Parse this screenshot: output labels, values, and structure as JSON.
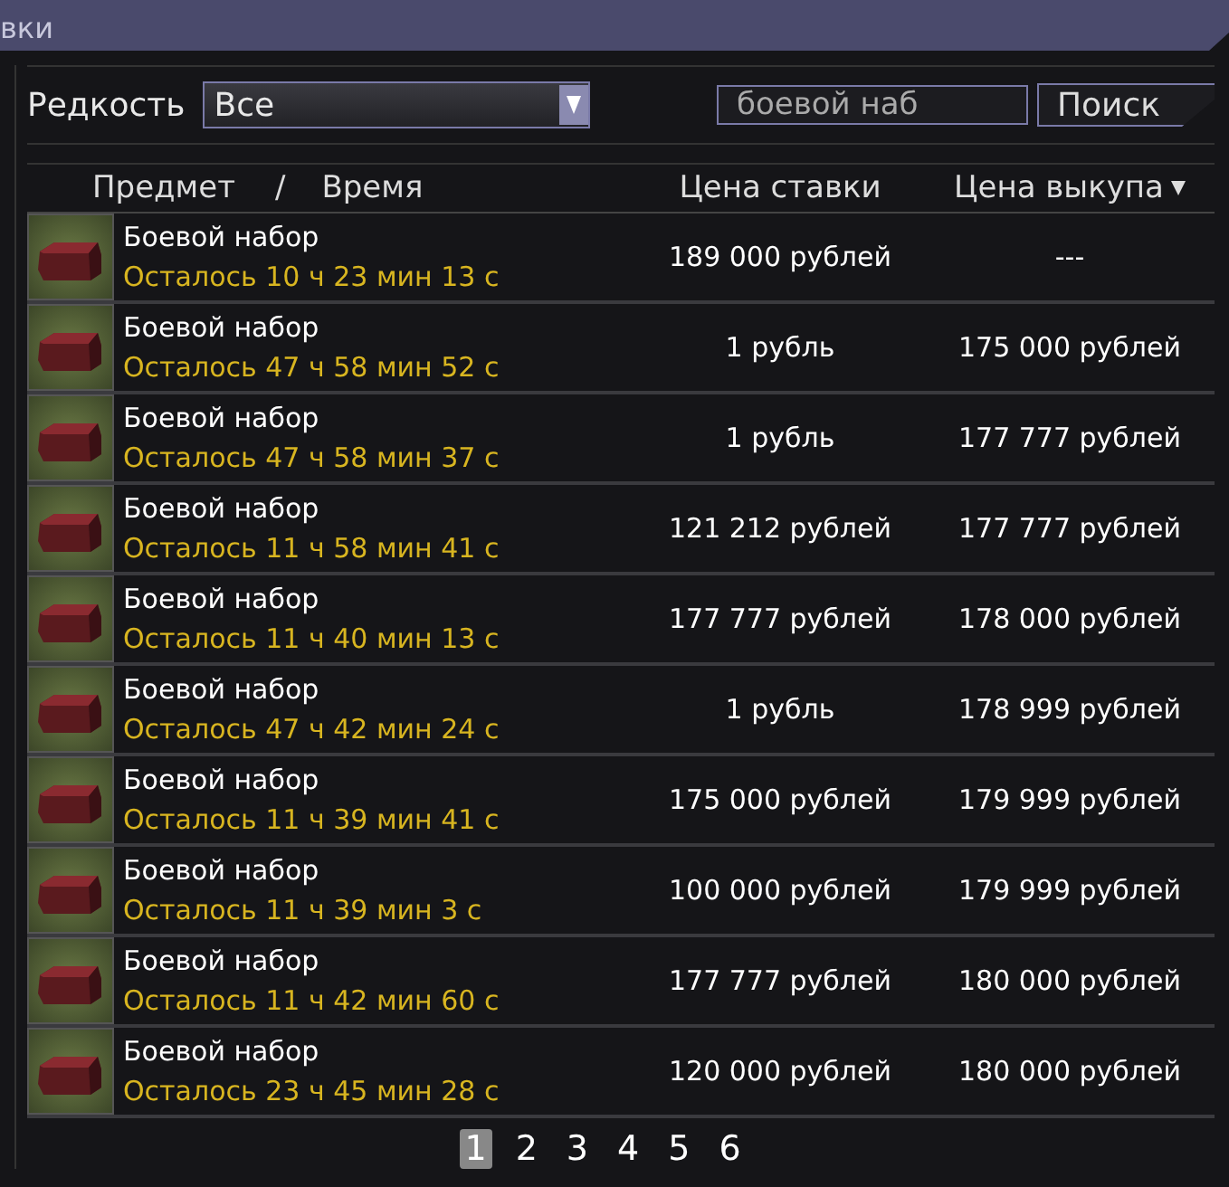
{
  "window": {
    "title": "вки"
  },
  "filters": {
    "rarity_label": "Редкость",
    "rarity_value": "Все",
    "search_value": "боевой наб",
    "search_button": "Поиск"
  },
  "columns": [
    {
      "label": "Предмет"
    },
    {
      "label": "/"
    },
    {
      "label": "Время"
    },
    {
      "label": "Цена ставки"
    },
    {
      "label": "Цена выкупа",
      "sorted": true
    }
  ],
  "rows": [
    {
      "name": "Боевой набор",
      "time": "Осталось 10 ч 23 мин 13 с",
      "bid": "189 000 рублей",
      "buyout": "---"
    },
    {
      "name": "Боевой набор",
      "time": "Осталось 47 ч 58 мин 52 с",
      "bid": "1 рубль",
      "buyout": "175 000 рублей"
    },
    {
      "name": "Боевой набор",
      "time": "Осталось 47 ч 58 мин 37 с",
      "bid": "1 рубль",
      "buyout": "177 777 рублей"
    },
    {
      "name": "Боевой набор",
      "time": "Осталось 11 ч 58 мин 41 с",
      "bid": "121 212 рублей",
      "buyout": "177 777 рублей"
    },
    {
      "name": "Боевой набор",
      "time": "Осталось 11 ч 40 мин 13 с",
      "bid": "177 777 рублей",
      "buyout": "178 000 рублей"
    },
    {
      "name": "Боевой набор",
      "time": "Осталось 47 ч 42 мин 24 с",
      "bid": "1 рубль",
      "buyout": "178 999 рублей"
    },
    {
      "name": "Боевой набор",
      "time": "Осталось 11 ч 39 мин 41 с",
      "bid": "175 000 рублей",
      "buyout": "179 999 рублей"
    },
    {
      "name": "Боевой набор",
      "time": "Осталось 11 ч 39 мин 3 с",
      "bid": "100 000 рублей",
      "buyout": "179 999 рублей"
    },
    {
      "name": "Боевой набор",
      "time": "Осталось 11 ч 42 мин 60 с",
      "bid": "177 777 рублей",
      "buyout": "180 000 рублей"
    },
    {
      "name": "Боевой набор",
      "time": "Осталось 23 ч 45 мин 28 с",
      "bid": "120 000 рублей",
      "buyout": "180 000 рублей"
    }
  ],
  "pages": [
    {
      "label": "1",
      "selected": true
    },
    {
      "label": "2",
      "selected": false
    },
    {
      "label": "3",
      "selected": false
    },
    {
      "label": "4",
      "selected": false
    },
    {
      "label": "5",
      "selected": false
    },
    {
      "label": "6",
      "selected": false
    }
  ]
}
